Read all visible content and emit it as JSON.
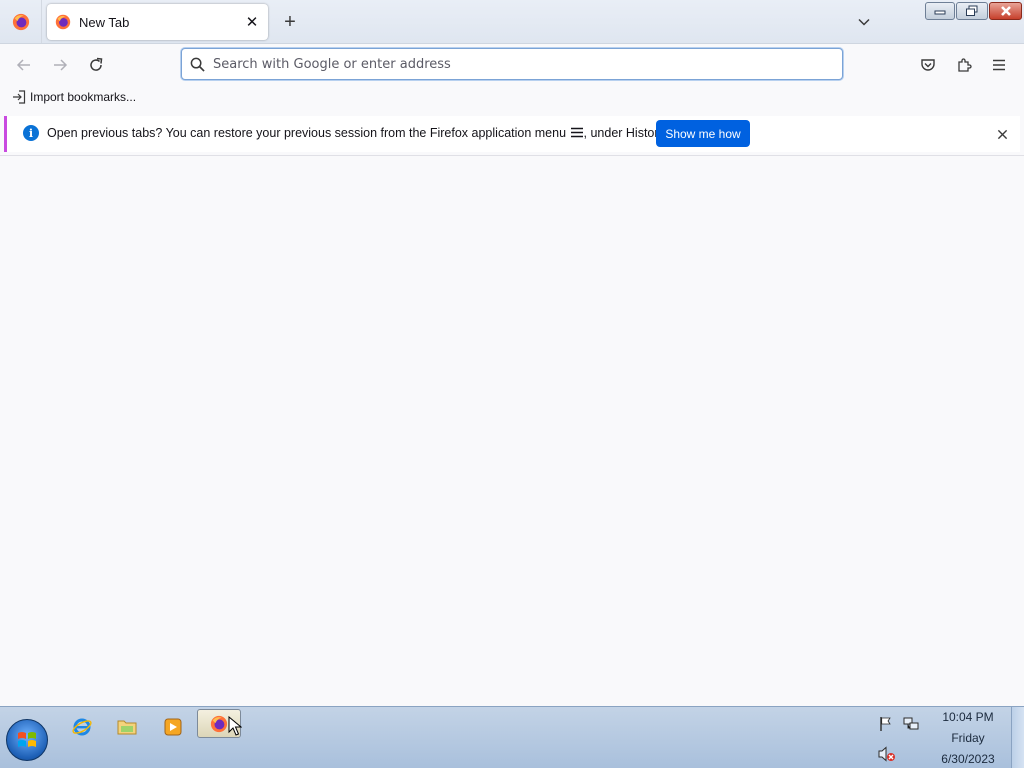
{
  "browser": {
    "tab": {
      "title": "New Tab",
      "close": "✕"
    },
    "new_tab": "+",
    "urlbar": {
      "placeholder": "Search with Google or enter address",
      "value": ""
    },
    "bookmarks": {
      "import_label": "Import bookmarks..."
    },
    "notification": {
      "message_before": "Open previous tabs? You can restore your previous session from the Firefox application menu ",
      "message_after": ", under History.",
      "info": "i",
      "button": "Show me how"
    }
  },
  "taskbar": {
    "clock": {
      "time": "10:04 PM",
      "day": "Friday",
      "date": "6/30/2023"
    }
  },
  "colors": {
    "accent": "#0061e0",
    "notice_stripe": "#c94ae0"
  }
}
